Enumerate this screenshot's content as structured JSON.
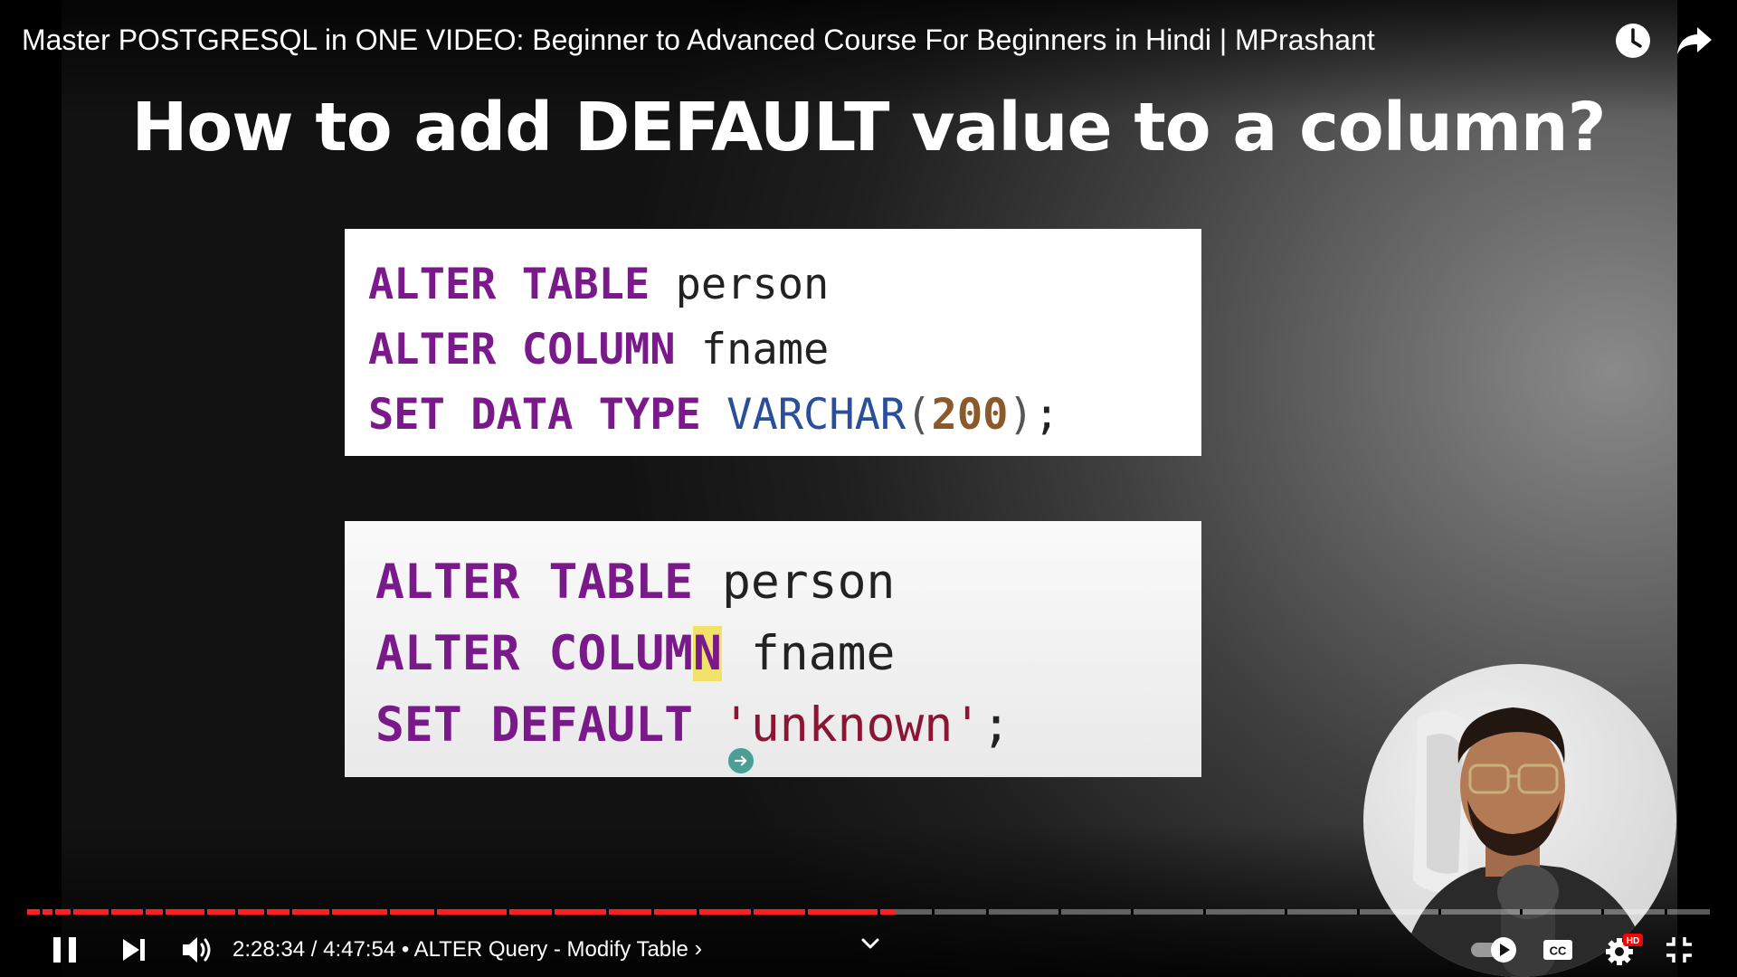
{
  "video": {
    "title": "Master POSTGRESQL in ONE VIDEO: Beginner to Advanced Course For Beginners in Hindi | MPrashant"
  },
  "top_actions": {
    "watch_later_icon": "clock-icon",
    "share_icon": "share-arrow-icon"
  },
  "slide": {
    "heading": "How to add DEFAULT value to a column?",
    "code_block_1": {
      "line1": {
        "kw1": "ALTER",
        "kw2": "TABLE",
        "ident": "person"
      },
      "line2": {
        "kw1": "ALTER",
        "kw2": "COLUMN",
        "ident": "fname"
      },
      "line3": {
        "kw1": "SET",
        "kw2": "DATA",
        "kw3": "TYPE",
        "type": "VARCHAR",
        "open": "(",
        "num": "200",
        "close": ")",
        "end": ";"
      }
    },
    "code_block_2": {
      "line1": {
        "kw1": "ALTER",
        "kw2": "TABLE",
        "ident": "person"
      },
      "line2": {
        "kw1": "ALTER",
        "kw2_pre": "COLUM",
        "kw2_cursor": "N",
        "ident": "fname"
      },
      "line3": {
        "kw1": "SET",
        "kw2": "DEFAULT",
        "str": "'unknown'",
        "end": ";"
      }
    }
  },
  "controls": {
    "current_time": "2:28:34",
    "separator": " / ",
    "duration": "4:47:54",
    "bullet": " • ",
    "chapter": "ALTER Query - Modify Table",
    "chapter_chevron": "›",
    "progress_fraction": 0.5154,
    "hd_badge": "HD"
  },
  "colors": {
    "progress_played": "#ff1f1f",
    "keyword": "#7a1a8a",
    "type": "#2a4f9a",
    "number": "#8b5a2b",
    "string": "#8a1535",
    "hd_badge": "#ff0000"
  }
}
